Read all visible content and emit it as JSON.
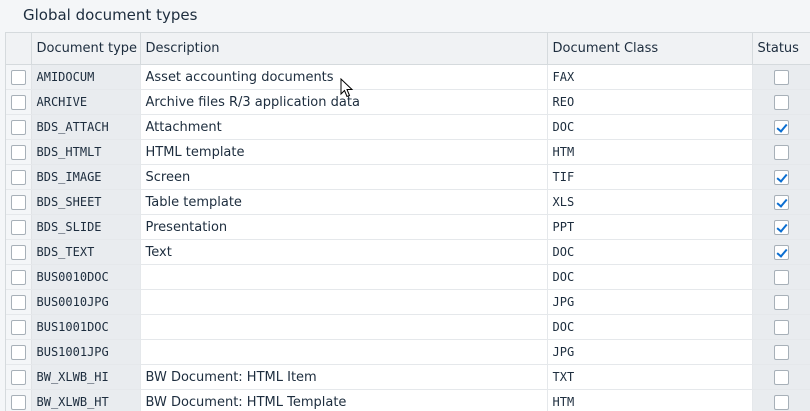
{
  "title": "Global document types",
  "columns": {
    "type": "Document type",
    "description": "Description",
    "class": "Document Class",
    "status": "Status"
  },
  "rows": [
    {
      "type": "AMIDOCUM",
      "description": "Asset accounting documents",
      "class": "FAX",
      "status": false
    },
    {
      "type": "ARCHIVE",
      "description": "Archive files R/3 application data",
      "class": "REO",
      "status": false
    },
    {
      "type": "BDS_ATTACH",
      "description": "Attachment",
      "class": "DOC",
      "status": true
    },
    {
      "type": "BDS_HTMLT",
      "description": "HTML template",
      "class": "HTM",
      "status": false
    },
    {
      "type": "BDS_IMAGE",
      "description": "Screen",
      "class": "TIF",
      "status": true
    },
    {
      "type": "BDS_SHEET",
      "description": "Table template",
      "class": "XLS",
      "status": true
    },
    {
      "type": "BDS_SLIDE",
      "description": "Presentation",
      "class": "PPT",
      "status": true
    },
    {
      "type": "BDS_TEXT",
      "description": "Text",
      "class": "DOC",
      "status": true
    },
    {
      "type": "BUS0010DOC",
      "description": "",
      "class": "DOC",
      "status": false
    },
    {
      "type": "BUS0010JPG",
      "description": "",
      "class": "JPG",
      "status": false
    },
    {
      "type": "BUS1001DOC",
      "description": "",
      "class": "DOC",
      "status": false
    },
    {
      "type": "BUS1001JPG",
      "description": "",
      "class": "JPG",
      "status": false
    },
    {
      "type": "BW_XLWB_HI",
      "description": "BW Document: HTML Item",
      "class": "TXT",
      "status": false
    },
    {
      "type": "BW_XLWB_HT",
      "description": "BW Document: HTML Template",
      "class": "HTM",
      "status": false
    }
  ],
  "colors": {
    "accent": "#0a6ed1",
    "key_column_bg": "#e9ecef"
  },
  "icons": {
    "cursor": "mouse-pointer-icon"
  }
}
